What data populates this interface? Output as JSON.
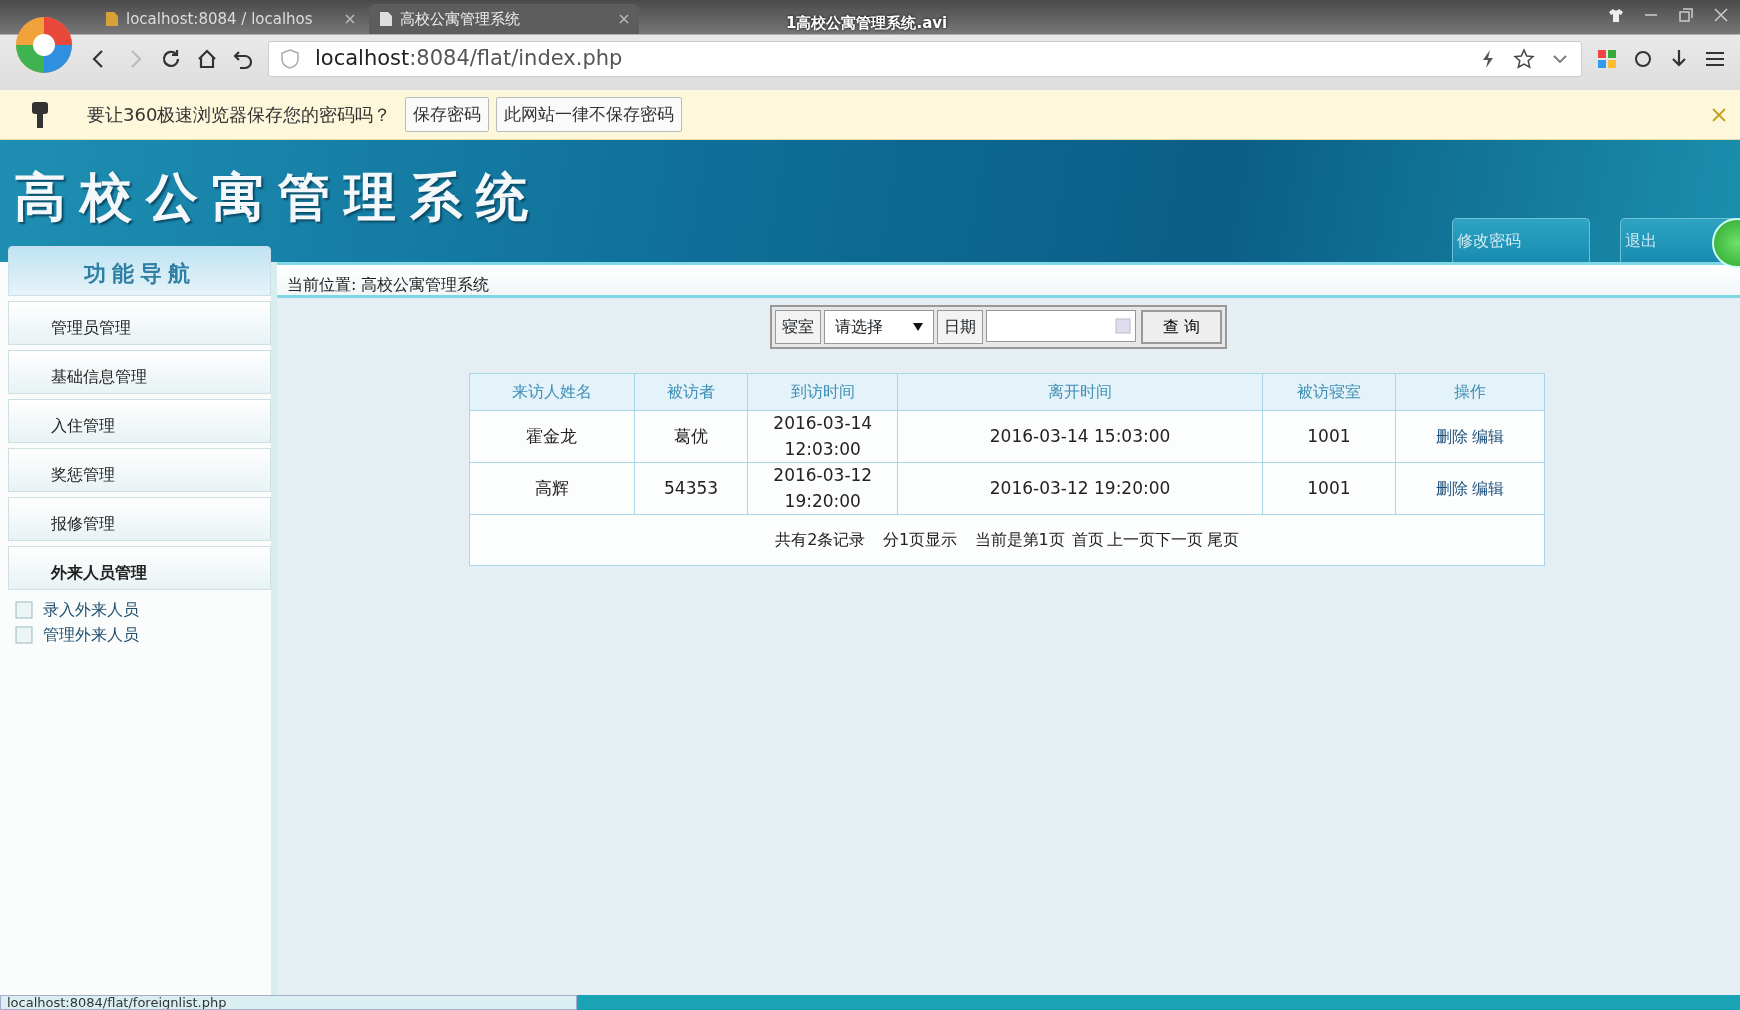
{
  "video_title": "1高校公寓管理系统.avi",
  "browser": {
    "tabs": [
      {
        "label": "localhost:8084 / localhos",
        "selected": false
      },
      {
        "label": "高校公寓管理系统",
        "selected": true
      }
    ],
    "address_host": "localhost",
    "address_rest": ":8084/flat/index.php"
  },
  "password_bar": {
    "message": "要让360极速浏览器保存您的密码吗？",
    "buttons": [
      "保存密码",
      "此网站一律不保存密码"
    ]
  },
  "header": {
    "title": "高校公寓管理系统",
    "buttons": [
      "修改密码",
      "退出"
    ]
  },
  "sidebar": {
    "title": "功能导航",
    "items": [
      {
        "label": "管理员管理",
        "expanded": false
      },
      {
        "label": "基础信息管理",
        "expanded": false
      },
      {
        "label": "入住管理",
        "expanded": false
      },
      {
        "label": "奖惩管理",
        "expanded": false
      },
      {
        "label": "报修管理",
        "expanded": false
      },
      {
        "label": "外来人员管理",
        "expanded": true,
        "children": [
          {
            "label": "录入外来人员"
          },
          {
            "label": "管理外来人员"
          }
        ]
      }
    ]
  },
  "breadcrumb": "当前位置: 高校公寓管理系统",
  "search": {
    "dorm_label": "寝室",
    "select_value": "请选择",
    "date_label": "日期",
    "button": "查 询"
  },
  "table": {
    "columns": [
      "来访人姓名",
      "被访者",
      "到访时间",
      "离开时间",
      "被访寝室",
      "操作"
    ],
    "rows": [
      {
        "cells": [
          "霍金龙",
          "葛优",
          "2016-03-14 12:03:00",
          "2016-03-14 15:03:00",
          "1001"
        ],
        "actions": [
          "删除",
          "编辑"
        ]
      },
      {
        "cells": [
          "高辉",
          "54353",
          "2016-03-12 19:20:00",
          "2016-03-12 19:20:00",
          "1001"
        ],
        "actions": [
          "删除",
          "编辑"
        ]
      }
    ]
  },
  "pagination": {
    "summary": "共有2条记录",
    "pages": "分1页显示",
    "current": "当前是第1页",
    "links": [
      "首页",
      "上一页下一页",
      "尾页"
    ]
  },
  "status_url": "localhost:8084/flat/foreignlist.php"
}
